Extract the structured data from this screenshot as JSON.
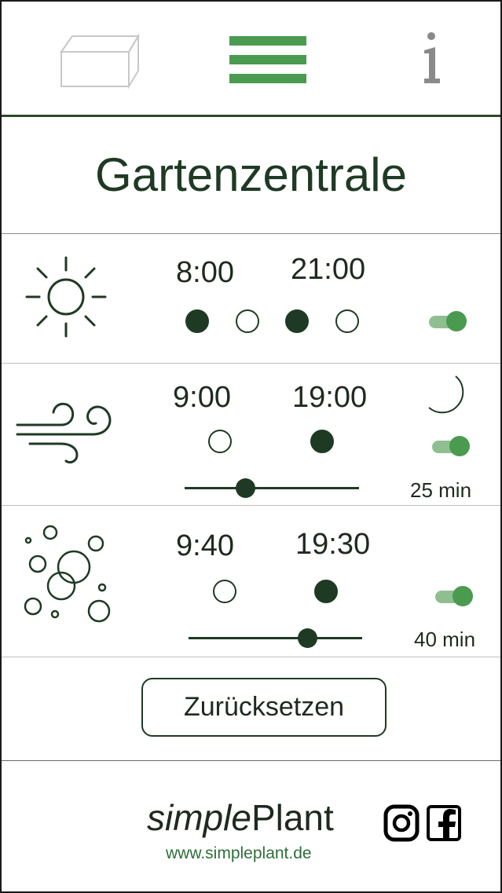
{
  "nav": {
    "items": [
      {
        "icon": "box-icon"
      },
      {
        "icon": "menu-icon",
        "active": true,
        "color": "#4a9a50"
      },
      {
        "icon": "info-icon"
      }
    ]
  },
  "title": "Gartenzentrale",
  "rows": [
    {
      "icon": "sun-icon",
      "time_start": "8:00",
      "time_end": "21:00",
      "dots": [
        true,
        false,
        true,
        false
      ],
      "moon": "moon-filled-icon",
      "toggle_on": true
    },
    {
      "icon": "wind-icon",
      "time_start": "9:00",
      "time_end": "19:00",
      "dots": [
        false,
        true
      ],
      "moon": "moon-outline-icon",
      "toggle_on": true,
      "slider_fraction": 0.33,
      "duration": "25 min"
    },
    {
      "icon": "bubbles-icon",
      "time_start": "9:40",
      "time_end": "19:30",
      "dots": [
        false,
        true
      ],
      "moon": "moon-filled-icon",
      "toggle_on": true,
      "slider_fraction": 0.71,
      "duration": "40 min"
    }
  ],
  "reset_label": "Zurücksetzen",
  "footer": {
    "brand_italic": "simple",
    "brand_regular": "Plant",
    "url": "www.simpleplant.de",
    "social": [
      "instagram-icon",
      "facebook-icon"
    ]
  },
  "colors": {
    "dark_green": "#1f3a24",
    "accent_green": "#4a9a50",
    "url_green": "#2e6f3a"
  }
}
